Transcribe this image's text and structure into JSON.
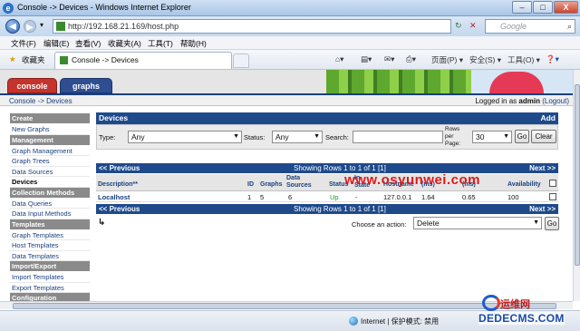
{
  "window": {
    "title": "Console -> Devices - Windows Internet Explorer",
    "min": "–",
    "max": "□",
    "close": "X"
  },
  "address": {
    "url": "http://192.168.21.169/host.php",
    "search_placeholder": "Google"
  },
  "menu": [
    "文件(F)",
    "编辑(E)",
    "查看(V)",
    "收藏夹(A)",
    "工具(T)",
    "帮助(H)"
  ],
  "favbar": {
    "favorites": "收藏夹",
    "tab_title": "Console -> Devices",
    "page_menu": "页面(P)",
    "safety_menu": "安全(S)",
    "tools_menu": "工具(O)"
  },
  "cacti": {
    "tabs": [
      "console",
      "graphs"
    ],
    "breadcrumb": "Console -> Devices",
    "login_prefix": "Logged in as ",
    "user": "admin",
    "logout": "(Logout)"
  },
  "sidebar": [
    {
      "type": "header",
      "label": "Create"
    },
    {
      "type": "item",
      "label": "New Graphs"
    },
    {
      "type": "header",
      "label": "Management"
    },
    {
      "type": "item",
      "label": "Graph Management"
    },
    {
      "type": "item",
      "label": "Graph Trees"
    },
    {
      "type": "item",
      "label": "Data Sources"
    },
    {
      "type": "item",
      "label": "Devices",
      "selected": true
    },
    {
      "type": "header",
      "label": "Collection Methods"
    },
    {
      "type": "item",
      "label": "Data Queries"
    },
    {
      "type": "item",
      "label": "Data Input Methods"
    },
    {
      "type": "header",
      "label": "Templates"
    },
    {
      "type": "item",
      "label": "Graph Templates"
    },
    {
      "type": "item",
      "label": "Host Templates"
    },
    {
      "type": "item",
      "label": "Data Templates"
    },
    {
      "type": "header",
      "label": "Import/Export"
    },
    {
      "type": "item",
      "label": "Import Templates"
    },
    {
      "type": "item",
      "label": "Export Templates"
    },
    {
      "type": "header",
      "label": "Configuration"
    }
  ],
  "devices": {
    "title": "Devices",
    "add": "Add",
    "filter": {
      "type_label": "Type:",
      "type_value": "Any",
      "status_label": "Status:",
      "status_value": "Any",
      "search_label": "Search:",
      "search_value": "",
      "rows_label": "Rows per Page:",
      "rows_value": "30",
      "go": "Go",
      "clear": "Clear"
    },
    "nav": {
      "prev": "<< Previous",
      "showing": "Showing Rows 1 to 1 of 1 [1]",
      "next": "Next >>"
    },
    "columns": {
      "description": "Description**",
      "id": "ID",
      "graphs": "Graphs",
      "data_sources": "Data Sources",
      "status": "Status",
      "in_state": "In State",
      "hostname": "Hostname",
      "current": "(ms)",
      "average": "(ms)",
      "availability": "Availability"
    },
    "row": {
      "description": "Localhost",
      "id": "1",
      "graphs": "5",
      "data_sources": "6",
      "status": "Up",
      "in_state": "-",
      "hostname": "127.0.0.1",
      "current": "1.64",
      "average": "0.65",
      "availability": "100"
    },
    "action": {
      "label": "Choose an action:",
      "value": "Delete",
      "go": "Go"
    }
  },
  "watermark": "www.osyunwei.com",
  "status": {
    "zone": "Internet | 保护模式: 禁用"
  },
  "logo": {
    "top": "运维网",
    "bottom": "DEDECMS.COM"
  },
  "colors": {
    "cacti_blue": "#1e4a8c",
    "console_red": "#c4342c",
    "graphs_blue": "#2e4e91",
    "status_up": "#18a018",
    "watermark_red": "#e01818"
  }
}
